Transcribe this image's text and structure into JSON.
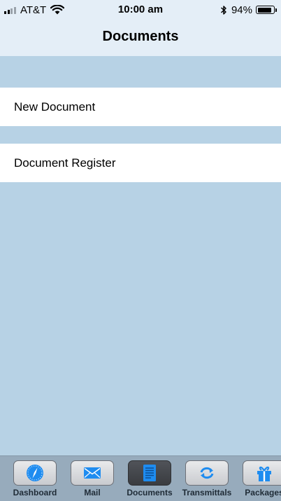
{
  "status_bar": {
    "carrier": "AT&T",
    "time": "10:00 am",
    "battery_percent_label": "94%",
    "battery_level": 0.94,
    "signal_bars_filled": 2,
    "signal_bars_total": 4
  },
  "nav": {
    "title": "Documents"
  },
  "list": {
    "items": [
      {
        "label": "New Document"
      },
      {
        "label": "Document Register"
      }
    ]
  },
  "tabs": [
    {
      "label": "Dashboard",
      "icon": "compass-icon"
    },
    {
      "label": "Mail",
      "icon": "envelope-icon"
    },
    {
      "label": "Documents",
      "icon": "document-icon",
      "active": true
    },
    {
      "label": "Transmittals",
      "icon": "refresh-arrows-icon"
    },
    {
      "label": "Packages",
      "icon": "gift-icon"
    }
  ],
  "colors": {
    "background": "#b7d2e5",
    "nav_background": "#e4eef7",
    "tab_bar": "#97abbc",
    "icon_blue": "#1e8cf0"
  }
}
